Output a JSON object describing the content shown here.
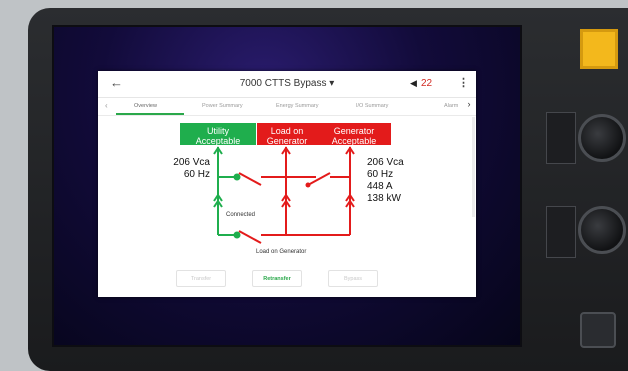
{
  "header": {
    "title": "7000 CTTS Bypass ▾",
    "back_icon": "←",
    "volume_icon": "◀",
    "alarm_count": "22",
    "menu_icon": "⋮"
  },
  "tabs": {
    "items": [
      "Overview",
      "Power Summary",
      "Energy Summary",
      "I/O Summary",
      "Alarm"
    ],
    "active": "Overview",
    "left_arrow": "‹",
    "right_arrow": "›"
  },
  "diagram": {
    "utility_box": {
      "line1": "Utility",
      "line2": "Acceptable"
    },
    "load_box": {
      "line1": "Load on",
      "line2": "Generator"
    },
    "generator_box": {
      "line1": "Generator",
      "line2": "Acceptable"
    },
    "utility_values": [
      "206 Vca",
      "60 Hz"
    ],
    "generator_values": [
      "206 Vca",
      "60 Hz",
      "448 A",
      "138 kW"
    ],
    "connected_label": "Connected",
    "status_label": "Load on Generator"
  },
  "actions": {
    "transfer": "Transfer",
    "retransfer": "Retransfer",
    "bypass": "Bypass"
  },
  "colors": {
    "utility": "#1fae4d",
    "generator": "#e31b1b",
    "bezel": "#1f2023",
    "hardware_button": "#f3b81c"
  }
}
